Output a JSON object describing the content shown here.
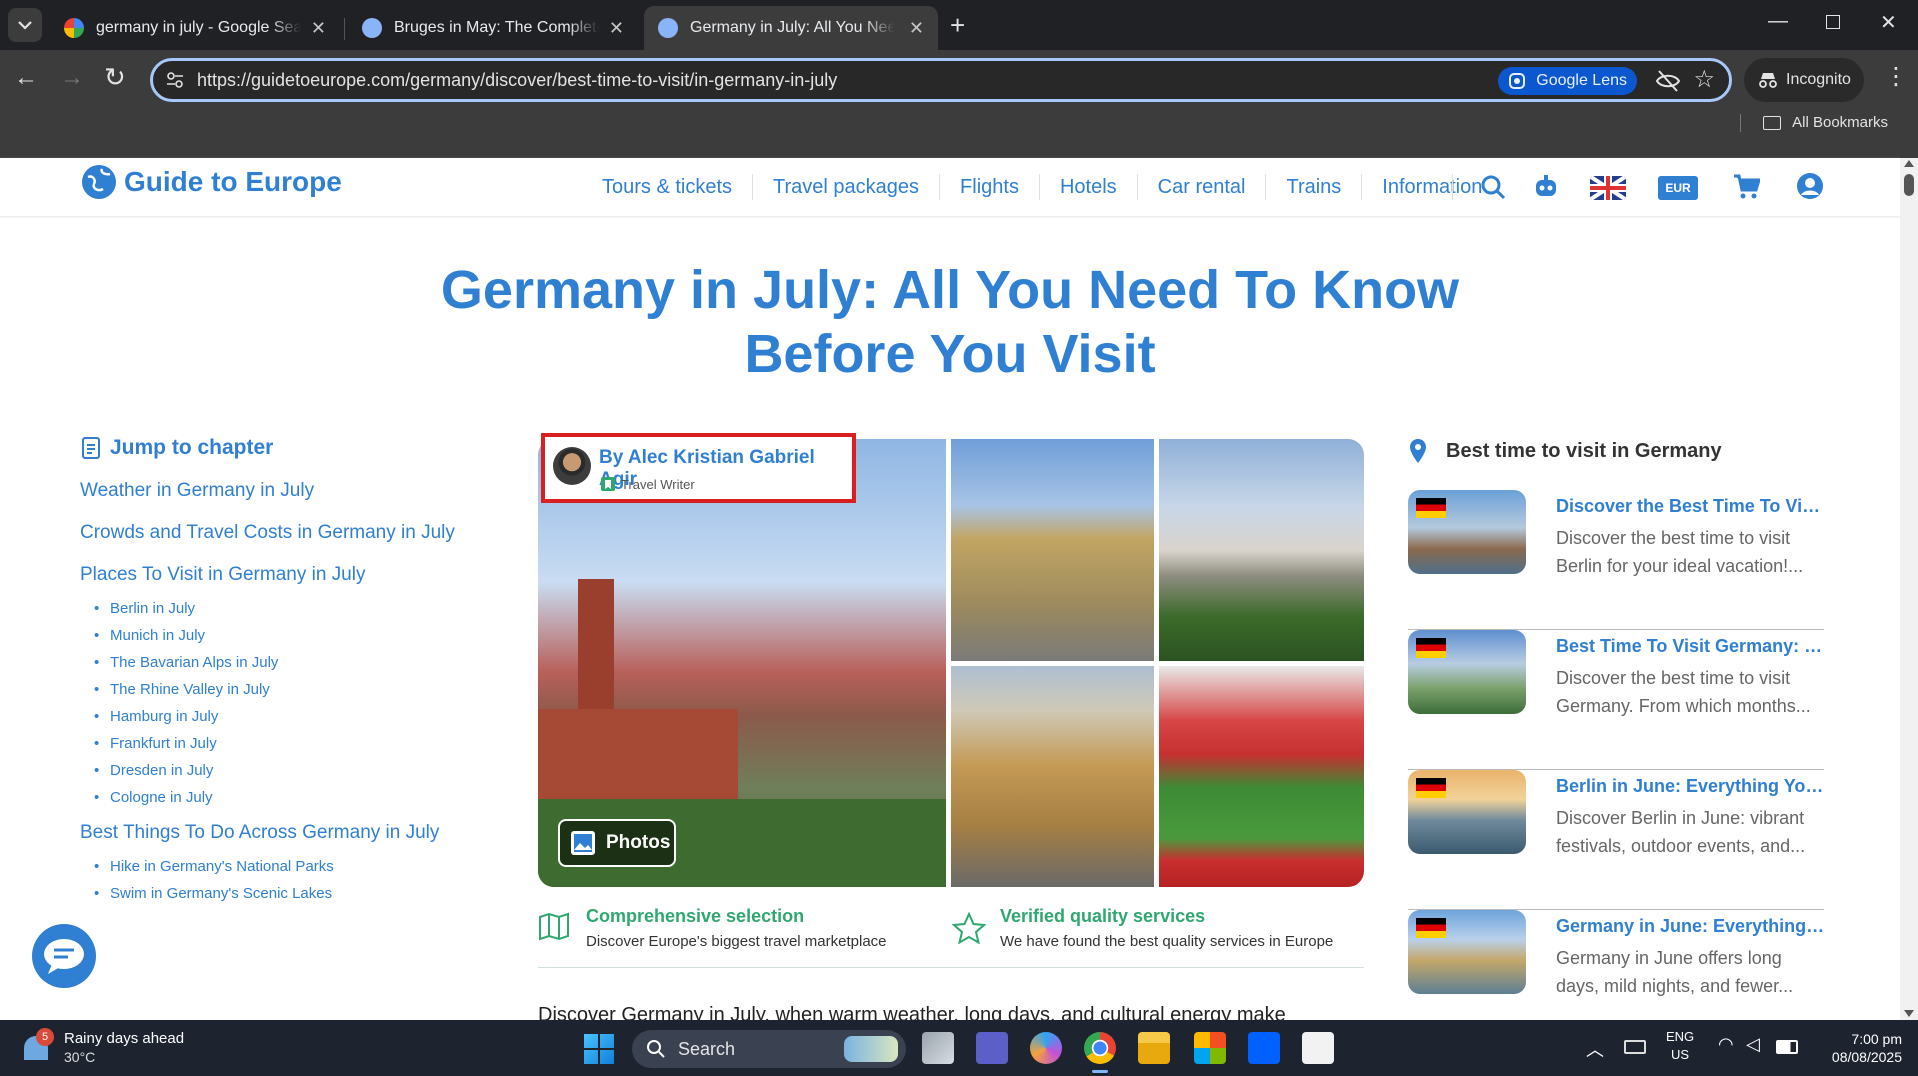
{
  "browser": {
    "tabs": [
      {
        "title": "germany in july - Google Search",
        "active": false
      },
      {
        "title": "Bruges in May: The Complete Travel Guide",
        "active": false
      },
      {
        "title": "Germany in July: All You Need To Know",
        "active": true
      }
    ],
    "url": "https://guidetoeurope.com/germany/discover/best-time-to-visit/in-germany-in-july",
    "lens_label": "Google Lens",
    "incognito_label": "Incognito",
    "bookmarks_label": "All Bookmarks"
  },
  "site": {
    "logo": "Guide to Europe",
    "nav": [
      "Tours & tickets",
      "Travel packages",
      "Flights",
      "Hotels",
      "Car rental",
      "Trains",
      "Information"
    ],
    "currency": "EUR",
    "accent": "#2f7fd2"
  },
  "page": {
    "title": "Germany in July: All You Need To Know Before You Visit",
    "author_name": "By Alec Kristian Gabriel Agir",
    "author_role": "Travel Writer",
    "photos_label": "Photos",
    "intro": "Discover Germany in July, when warm weather, long days, and cultural energy make"
  },
  "toc": {
    "heading": "Jump to chapter",
    "items": [
      {
        "label": "Weather in Germany in July",
        "sub": []
      },
      {
        "label": "Crowds and Travel Costs in Germany in July",
        "sub": []
      },
      {
        "label": "Places To Visit in Germany in July",
        "sub": [
          "Berlin in July",
          "Munich in July",
          "The Bavarian Alps in July",
          "The Rhine Valley in July",
          "Hamburg in July",
          "Frankfurt in July",
          "Dresden in July",
          "Cologne in July"
        ]
      },
      {
        "label": "Best Things To Do Across Germany in July",
        "sub": [
          "Hike in Germany's National Parks",
          "Swim in Germany's Scenic Lakes"
        ]
      }
    ]
  },
  "features": [
    {
      "title": "Comprehensive selection",
      "desc": "Discover Europe's biggest travel marketplace",
      "icon": "map-icon"
    },
    {
      "title": "Verified quality services",
      "desc": "We have found the best quality services in Europe",
      "icon": "star-icon"
    }
  ],
  "sidebar": {
    "heading": "Best time to visit in Germany",
    "cards": [
      {
        "title": "Discover the Best Time To Visit Berlin",
        "desc": "Discover the best time to visit Berlin for your ideal vacation!..."
      },
      {
        "title": "Best Time To Visit Germany: The Ultimate Guide",
        "desc": "Discover the best time to visit Germany. From which months..."
      },
      {
        "title": "Berlin in June: Everything You Need To Know",
        "desc": "Discover Berlin in June: vibrant festivals, outdoor events, and..."
      },
      {
        "title": "Germany in June: Everything You Need To Know",
        "desc": "Germany in June offers long days, mild nights, and fewer..."
      }
    ]
  },
  "taskbar": {
    "weather_title": "Rainy days ahead",
    "weather_temp": "30°C",
    "weather_badge": "5",
    "search_label": "Search",
    "lang_line1": "ENG",
    "lang_line2": "US",
    "time": "7:00 pm",
    "date": "08/08/2025"
  }
}
